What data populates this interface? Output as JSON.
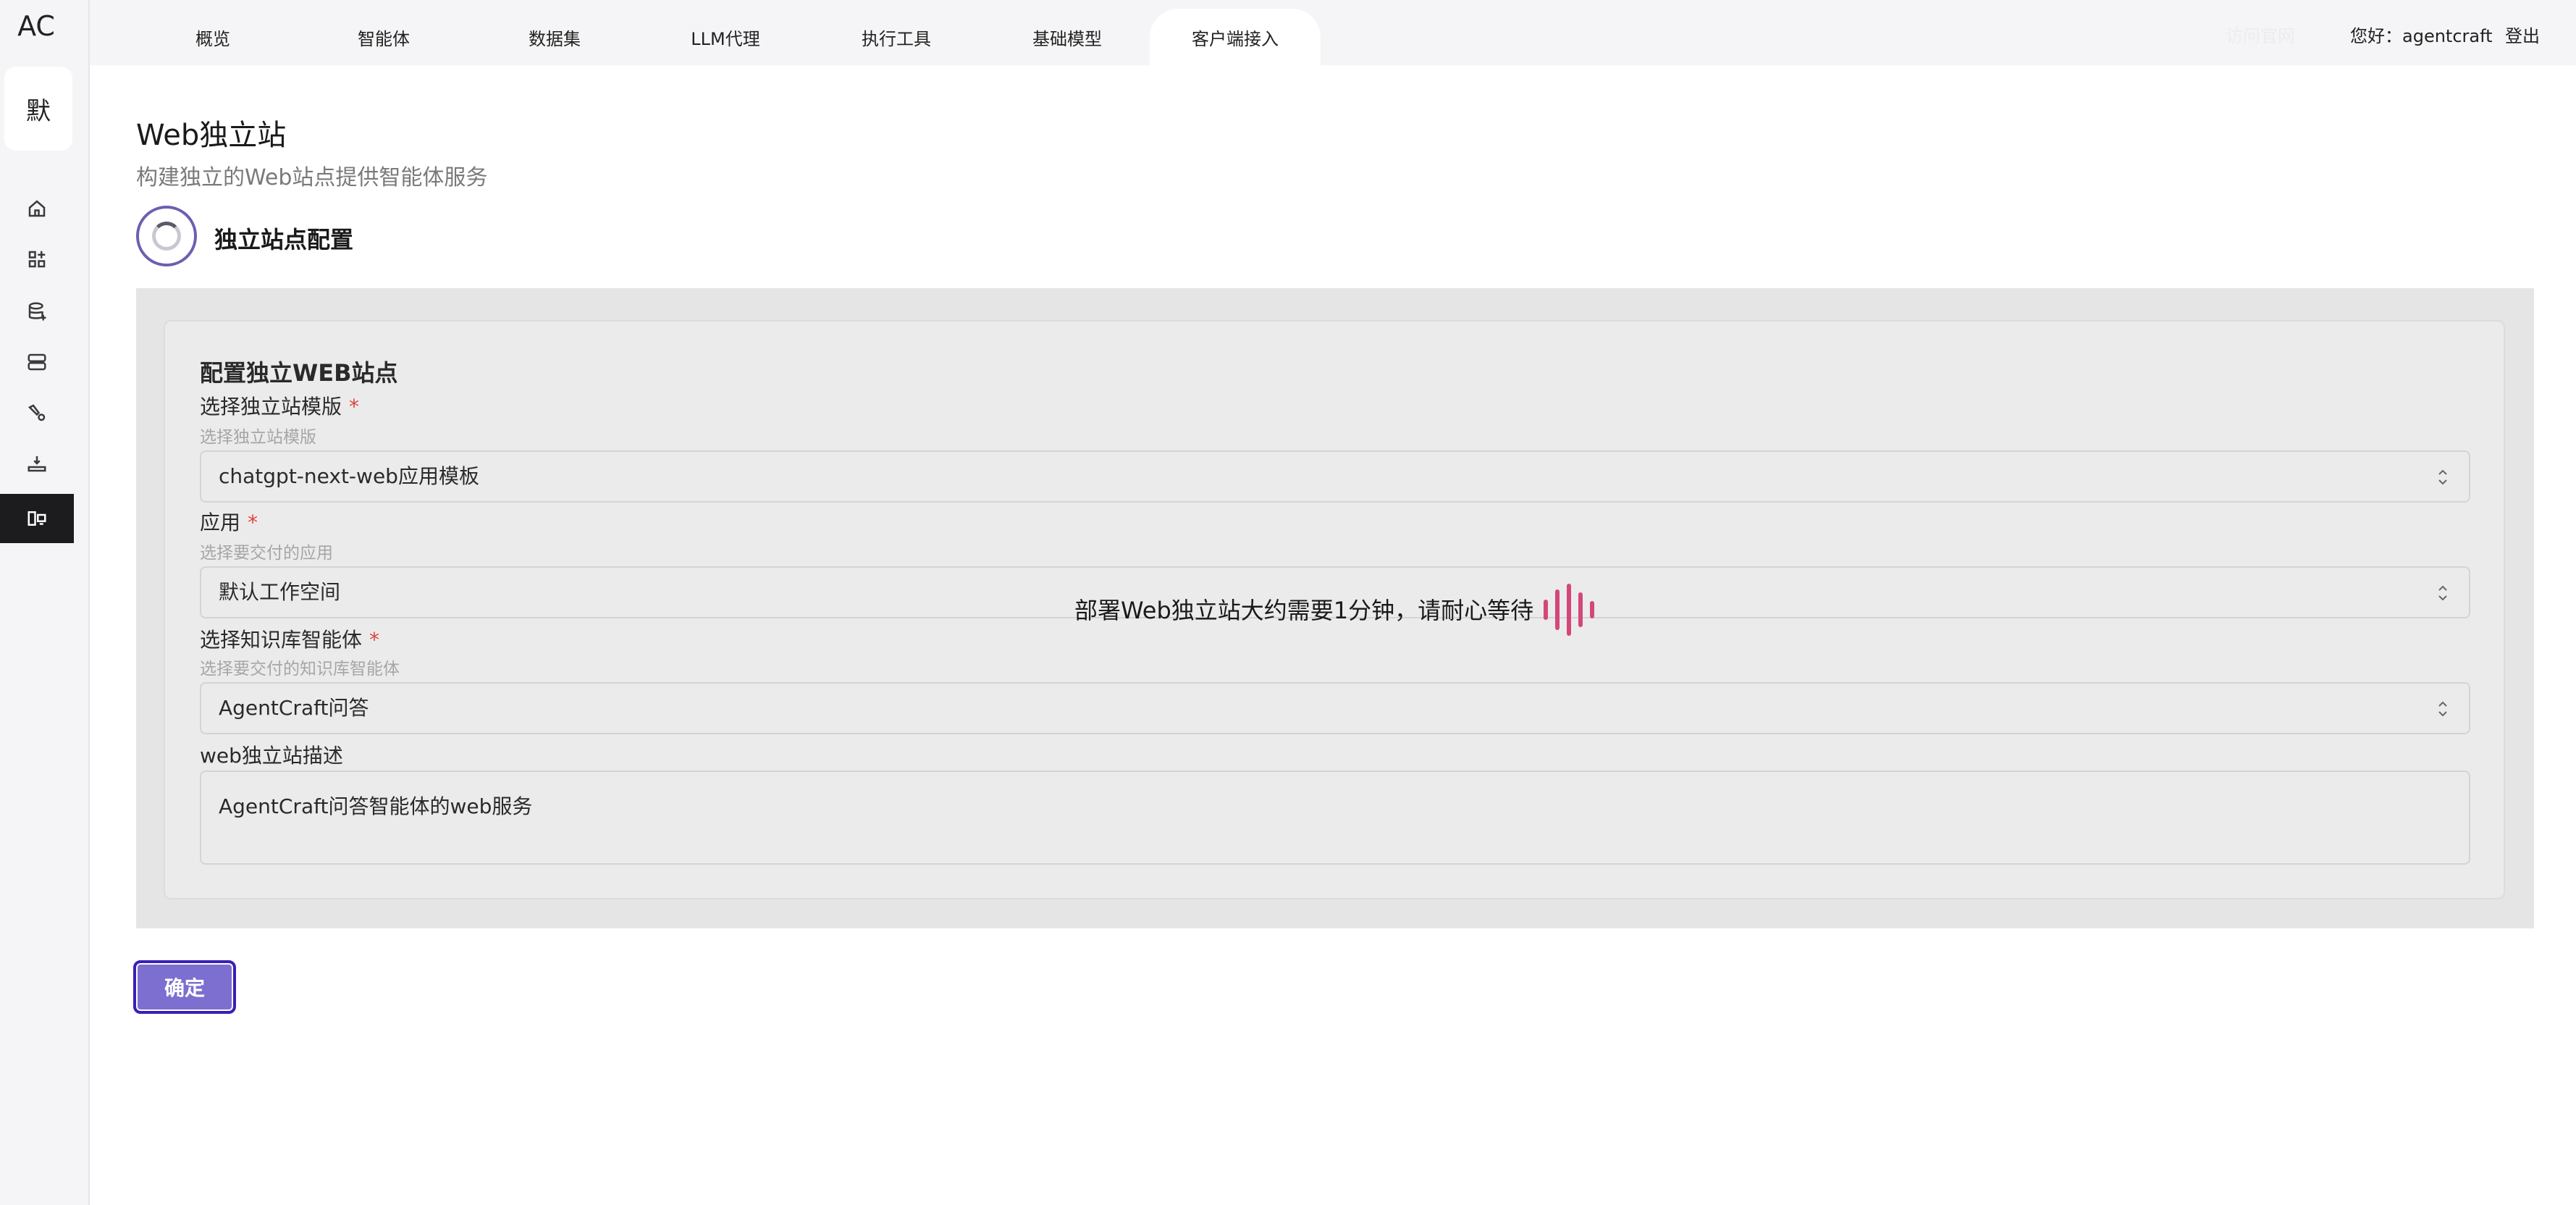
{
  "app": {
    "logo": "AC",
    "workspace_badge": "默"
  },
  "topbar": {
    "tabs": [
      {
        "label": "概览"
      },
      {
        "label": "智能体"
      },
      {
        "label": "数据集"
      },
      {
        "label": "LLM代理"
      },
      {
        "label": "执行工具"
      },
      {
        "label": "基础模型"
      },
      {
        "label": "客户端接入",
        "active": true
      }
    ],
    "official_site": "访问官网",
    "greeting": "您好：agentcraft",
    "logout": "登出"
  },
  "sidebar": {
    "icons": [
      "home-icon",
      "apps-icon",
      "database-add-icon",
      "server-icon",
      "tool-icon",
      "deploy-icon",
      "client-access-icon"
    ],
    "active_index": 6
  },
  "page": {
    "title": "Web独立站",
    "subtitle": "构建独立的Web站点提供智能体服务",
    "step_label": "独立站点配置"
  },
  "form": {
    "card_title": "配置独立WEB站点",
    "template": {
      "label": "选择独立站模版",
      "help": "选择独立站模版",
      "value": "chatgpt-next-web应用模板"
    },
    "app": {
      "label": "应用",
      "help": "选择要交付的应用",
      "value": "默认工作空间"
    },
    "agent": {
      "label": "选择知识库智能体",
      "help": "选择要交付的知识库智能体",
      "value": "AgentCraft问答"
    },
    "description": {
      "label": "web独立站描述",
      "value": "AgentCraft问答智能体的web服务"
    },
    "required_mark": "*"
  },
  "loading": {
    "message": "部署Web独立站大约需要1分钟，请耐心等待"
  },
  "actions": {
    "confirm": "确定"
  },
  "colors": {
    "accent": "#7c6fd0",
    "accent_border": "#3b1fb8",
    "loader": "#d4477a",
    "required": "#e0443e"
  }
}
